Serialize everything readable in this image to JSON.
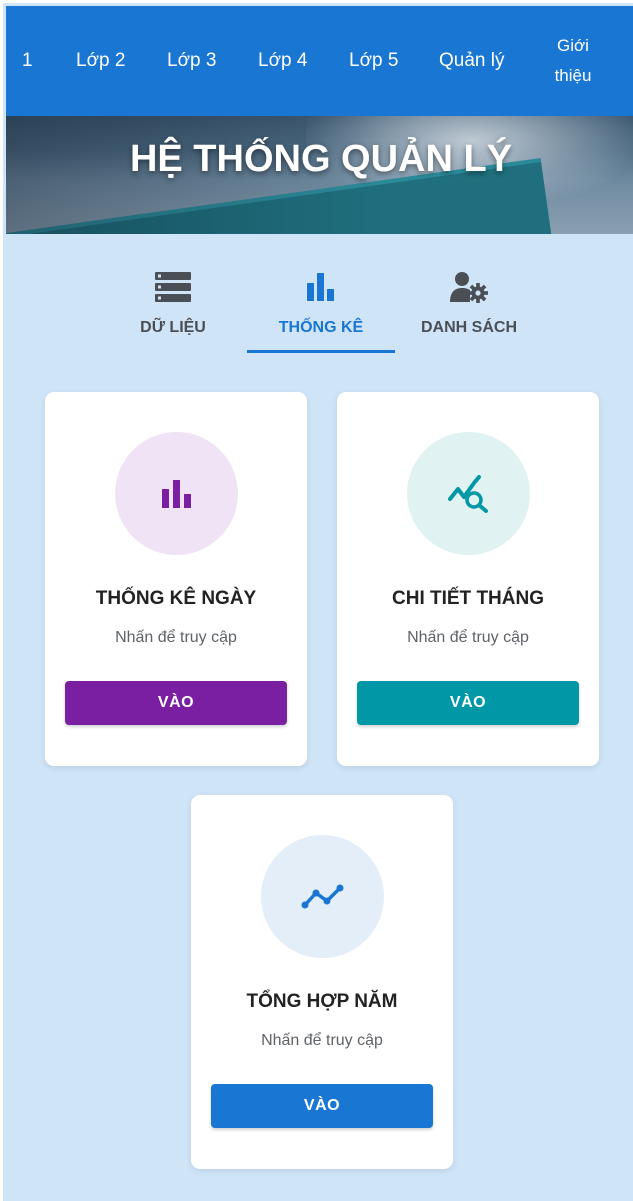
{
  "nav": {
    "items": [
      {
        "label": "1"
      },
      {
        "label": "Lớp 2"
      },
      {
        "label": "Lớp 3"
      },
      {
        "label": "Lớp 4"
      },
      {
        "label": "Lớp 5"
      },
      {
        "label": "Quản lý"
      },
      {
        "label_line1": "Giới",
        "label_line2": "thiệu"
      }
    ],
    "color": "#1976d2"
  },
  "hero": {
    "title": "HỆ THỐNG QUẢN LÝ"
  },
  "tabs": [
    {
      "label": "DỮ LIỆU",
      "icon": "server-icon",
      "active": false
    },
    {
      "label": "THỐNG KÊ",
      "icon": "bar-chart-icon",
      "active": true
    },
    {
      "label": "DANH SÁCH",
      "icon": "user-gear-icon",
      "active": false
    }
  ],
  "cards": [
    {
      "title": "THỐNG KÊ NGÀY",
      "subtitle": "Nhấn để truy cập",
      "button": "VÀO",
      "icon": "bar-chart-icon",
      "accent": "#7b1fa2",
      "circle": "#f0e3f5"
    },
    {
      "title": "CHI TIẾT THÁNG",
      "subtitle": "Nhấn để truy cập",
      "button": "VÀO",
      "icon": "chart-search-icon",
      "accent": "#0097a7",
      "circle": "#e0f2f1"
    },
    {
      "title": "TỔNG HỢP NĂM",
      "subtitle": "Nhấn để truy cập",
      "button": "VÀO",
      "icon": "line-chart-icon",
      "accent": "#1976d2",
      "circle": "#e3eef9"
    }
  ],
  "colors": {
    "background": "#d0e4f7",
    "active_tab": "#1976d2",
    "inactive_tab": "#4a4f55"
  }
}
